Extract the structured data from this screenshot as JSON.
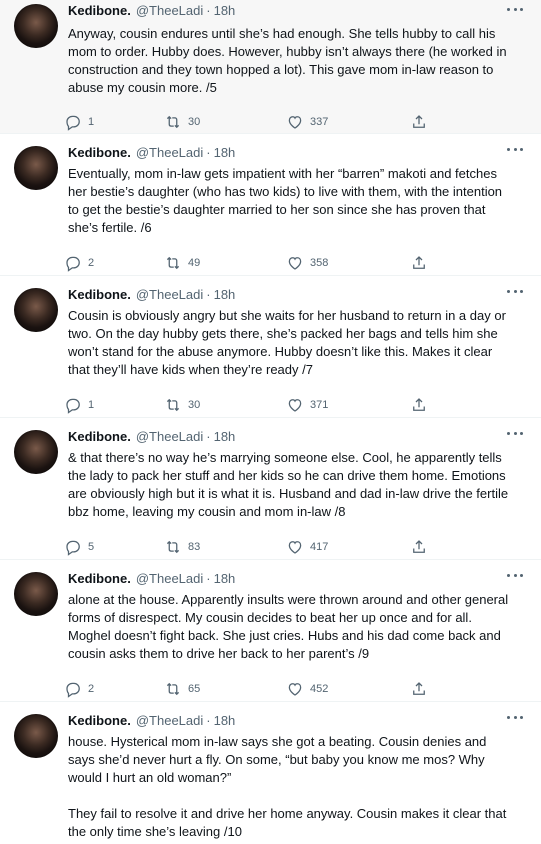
{
  "author": {
    "name": "Kedibone.",
    "handle": "@TheeLadi",
    "time": "18h",
    "separator": "·"
  },
  "tweets": [
    {
      "text": "Anyway, cousin endures until she’s had enough. She tells hubby to call his mom to order. Hubby does. However, hubby isn’t always there (he worked in construction and they town hopped a lot). This gave mom in-law reason to abuse my cousin more. /5",
      "replies": "1",
      "retweets": "30",
      "likes": "337"
    },
    {
      "text": "Eventually, mom in-law gets impatient with her “barren” makoti and fetches her bestie’s daughter (who has two kids) to live with them, with the intention to get the bestie’s daughter married to her son since she has proven that she’s fertile. /6",
      "replies": "2",
      "retweets": "49",
      "likes": "358"
    },
    {
      "text": "Cousin is obviously angry but she waits for her husband to return in a day or two. On the day hubby gets there, she’s packed her bags and tells him she won’t stand for the abuse anymore. Hubby doesn’t like this. Makes it clear that they’ll have kids when they’re ready /7",
      "replies": "1",
      "retweets": "30",
      "likes": "371"
    },
    {
      "text": "& that there’s no way he’s marrying someone else. Cool, he apparently tells the lady to pack her stuff and her kids so he can drive them home. Emotions are obviously high but it is what it is. Husband and dad in-law drive the fertile bbz home, leaving my cousin and mom in-law /8",
      "replies": "5",
      "retweets": "83",
      "likes": "417"
    },
    {
      "text": "alone at the house. Apparently insults were thrown around and other general forms of disrespect. My cousin decides to beat her up once and for all. Moghel doesn’t fight back. She just cries. Hubs and his dad come back and cousin asks them to drive her back to her parent’s /9",
      "replies": "2",
      "retweets": "65",
      "likes": "452"
    },
    {
      "text": "house. Hysterical mom in-law says she got a beating. Cousin denies and says she’d never hurt a fly. On some, “but baby you know me mos? Why would I hurt an old woman?”\n\nThey fail to resolve it and drive her home anyway. Cousin makes it clear that the only time she’s leaving /10",
      "replies": "",
      "retweets": "",
      "likes": ""
    }
  ],
  "icons": [
    "more-icon",
    "reply-icon",
    "retweet-icon",
    "like-icon",
    "share-icon"
  ]
}
